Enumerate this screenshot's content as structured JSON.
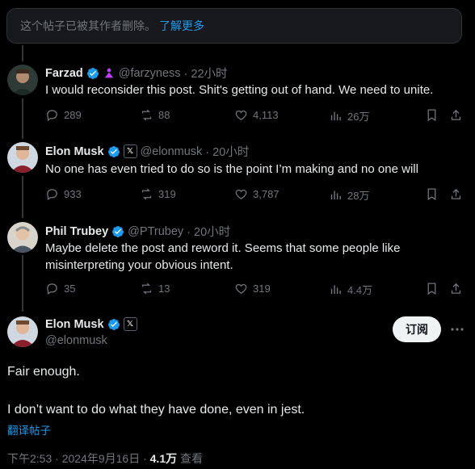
{
  "banner": {
    "text": "这个帖子已被其作者删除。",
    "link": "了解更多"
  },
  "replies": [
    {
      "name": "Farzad",
      "handle": "@farzyness",
      "time": "· 22小时",
      "text": "I would reconsider this post. Shit's getting out of hand. We need to unite.",
      "replies": "289",
      "reposts": "88",
      "likes": "4,113",
      "views": "26万"
    },
    {
      "name": "Elon Musk",
      "handle": "@elonmusk",
      "time": "· 20小时",
      "text": "No one has even tried to do so is the point I’m making and no one will",
      "replies": "933",
      "reposts": "319",
      "likes": "3,787",
      "views": "28万"
    },
    {
      "name": "Phil Trubey",
      "handle": "@PTrubey",
      "time": "· 20小时",
      "text_line1": "Maybe delete the post and reword it. Seems that some people like",
      "text_line2": "misinterpreting your obvious intent.",
      "replies": "35",
      "reposts": "13",
      "likes": "319",
      "views": "4.4万"
    }
  ],
  "main": {
    "name": "Elon Musk",
    "handle": "@elonmusk",
    "subscribe": "订阅",
    "line1": "Fair enough.",
    "line2": "I don’t want to do what they have done, even in jest.",
    "translate": "翻译帖子",
    "timestamp": "下午2:53 · 2024年9月16日 · ",
    "views": "4.1万",
    "views_label": " 查看"
  },
  "colors": {
    "accent": "#1d9bf0",
    "verified": "#1d9bf0",
    "background": "#000000",
    "muted": "#71767b"
  }
}
